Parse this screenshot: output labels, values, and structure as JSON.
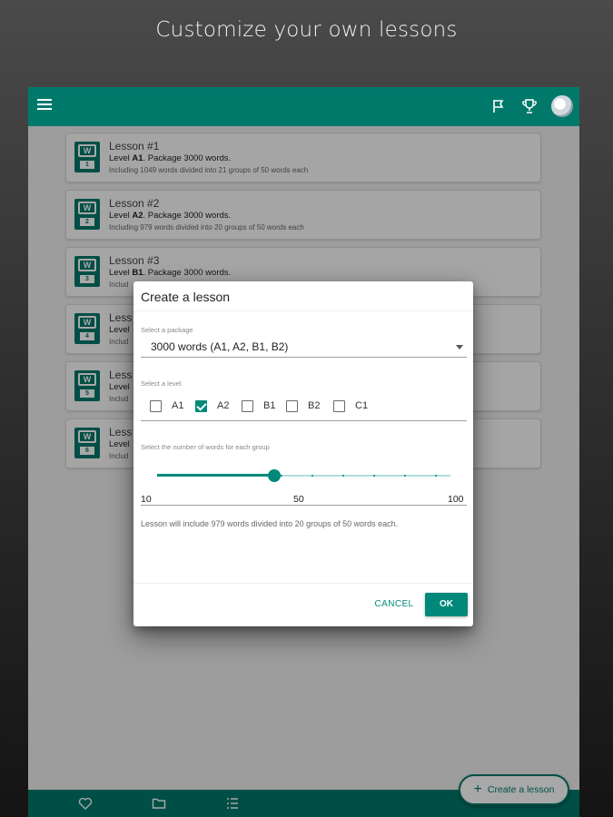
{
  "headline": "Customize your own lessons",
  "app_bar": {
    "icons": [
      "menu-icon",
      "flag-icon",
      "trophy-icon",
      "avatar"
    ]
  },
  "lessons": [
    {
      "title": "Lesson #1",
      "level_prefix": "Level ",
      "level": "A1",
      "level_suffix": ". Package 3000 words.",
      "detail": "Including 1049 words divided into 21 groups of 50 words each",
      "num": "1"
    },
    {
      "title": "Lesson #2",
      "level_prefix": "Level ",
      "level": "A2",
      "level_suffix": ". Package 3000 words.",
      "detail": "Including 979 words divided into 20 groups of 50 words each",
      "num": "2"
    },
    {
      "title": "Lesson #3",
      "level_prefix": "Level ",
      "level": "B1",
      "level_suffix": ". Package 3000 words.",
      "detail": "Includ",
      "num": "3"
    },
    {
      "title": "Less",
      "level_prefix": "Level",
      "level": "",
      "level_suffix": "",
      "detail": "Includ",
      "num": "4"
    },
    {
      "title": "Less",
      "level_prefix": "Level",
      "level": "",
      "level_suffix": "",
      "detail": "Includ",
      "num": "5"
    },
    {
      "title": "Less",
      "level_prefix": "Level",
      "level": "",
      "level_suffix": "",
      "detail": "Includ",
      "num": "6"
    }
  ],
  "fab_label": "Create a lesson",
  "bottom_nav": [
    "heart-icon",
    "folder-icon",
    "list-icon"
  ],
  "dialog": {
    "title": "Create a lesson",
    "package_label": "Select a package",
    "package_value": "3000 words (A1, A2, B1, B2)",
    "level_label": "Select a level",
    "levels": [
      {
        "label": "A1",
        "checked": false
      },
      {
        "label": "A2",
        "checked": true
      },
      {
        "label": "B1",
        "checked": false
      },
      {
        "label": "B2",
        "checked": false
      },
      {
        "label": "C1",
        "checked": false
      }
    ],
    "words_label": "Select the number of words for each group",
    "slider": {
      "min": "10",
      "max": "100",
      "value": "50",
      "value_num": 50,
      "min_num": 10,
      "max_num": 100
    },
    "summary": "Lesson will include 979 words divided into 20 groups of 50 words each.",
    "cancel": "CANCEL",
    "ok": "OK"
  },
  "colors": {
    "primary": "#00796b",
    "accent": "#00897b"
  }
}
